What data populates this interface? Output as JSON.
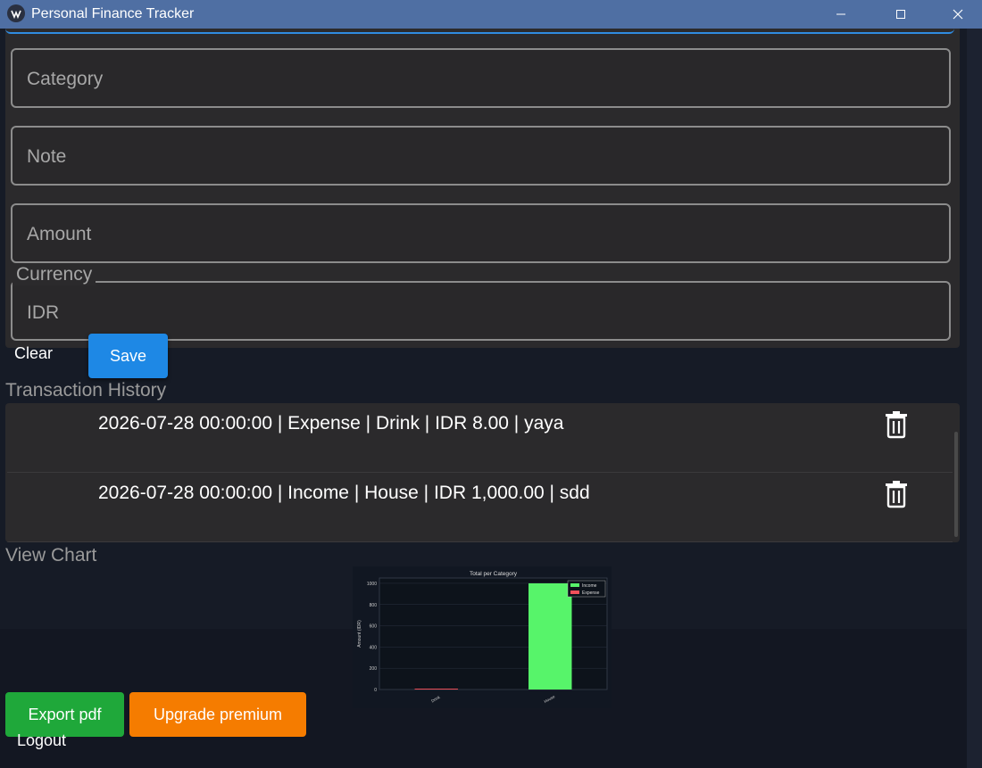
{
  "window": {
    "title": "Personal Finance Tracker"
  },
  "form": {
    "category_placeholder": "Category",
    "note_placeholder": "Note",
    "amount_placeholder": "Amount",
    "currency_label": "Currency",
    "currency_value": "IDR",
    "clear_label": "Clear",
    "save_label": "Save"
  },
  "history": {
    "title": "Transaction History",
    "items": [
      {
        "text": "2026-07-28 00:00:00 | Expense | Drink | IDR 8.00 | yaya"
      },
      {
        "text": "2026-07-28 00:00:00 | Income | House | IDR 1,000.00 | sdd"
      }
    ]
  },
  "chart_section": {
    "title": "View Chart"
  },
  "chart_data": {
    "type": "bar",
    "title": "Total per Category",
    "ylabel": "Amount (IDR)",
    "xlabel": "",
    "categories": [
      "Drink",
      "House"
    ],
    "series": [
      {
        "name": "Income",
        "values": [
          0,
          1000
        ],
        "color": "#57f46a"
      },
      {
        "name": "Expense",
        "values": [
          8,
          0
        ],
        "color": "#f2505a"
      }
    ],
    "ylim": [
      0,
      1050
    ],
    "yticks": [
      "0",
      "200",
      "400",
      "600",
      "800",
      "1000"
    ],
    "legend_position": "top-right",
    "grid": true
  },
  "actions": {
    "export_label": "Export pdf",
    "upgrade_label": "Upgrade premium",
    "logout_label": "Logout"
  },
  "colors": {
    "accent": "#1e88e5",
    "export": "#1fa83a",
    "upgrade": "#f57c00"
  }
}
